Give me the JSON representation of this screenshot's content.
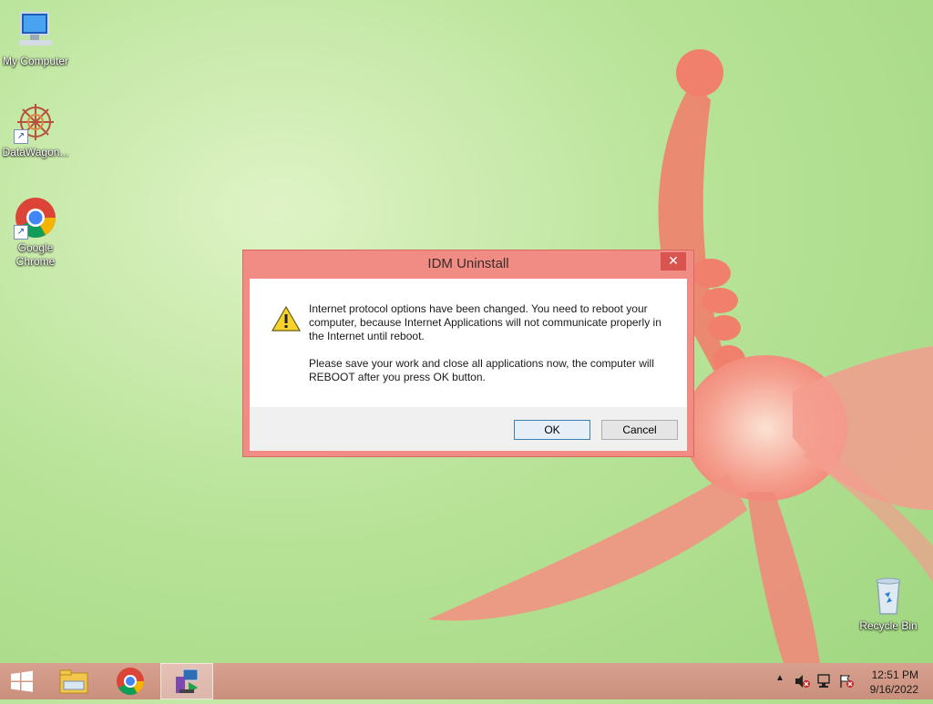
{
  "desktop": {
    "icons": [
      {
        "label": "My Computer",
        "icon": "computer-icon"
      },
      {
        "label": "DataWagon...",
        "icon": "datawagon-icon"
      },
      {
        "label": "Google Chrome",
        "icon": "chrome-icon"
      },
      {
        "label": "Recycle Bin",
        "icon": "recycle-bin-icon"
      }
    ]
  },
  "dialog": {
    "title": "IDM Uninstall",
    "close_label": "✕",
    "message_line1": "Internet protocol options have been changed. You need to reboot your computer, because Internet Applications will not communicate properly in the Internet until reboot.",
    "message_line2": "Please save your work and close all applications now, the computer will REBOOT after you press OK button.",
    "ok_label": "OK",
    "cancel_label": "Cancel",
    "icon": "warning-icon"
  },
  "taskbar": {
    "start_icon": "windows-start-icon",
    "pinned": [
      "file-explorer-icon",
      "chrome-icon",
      "idm-uninstaller-icon"
    ],
    "tray": {
      "show_hidden_label": "▲",
      "clock_time": "12:51 PM",
      "clock_date": "9/16/2022"
    }
  },
  "colors": {
    "dialog_frame": "#f08c84",
    "taskbar": "#c9907e",
    "accent_button_border": "#3c7fb1"
  }
}
